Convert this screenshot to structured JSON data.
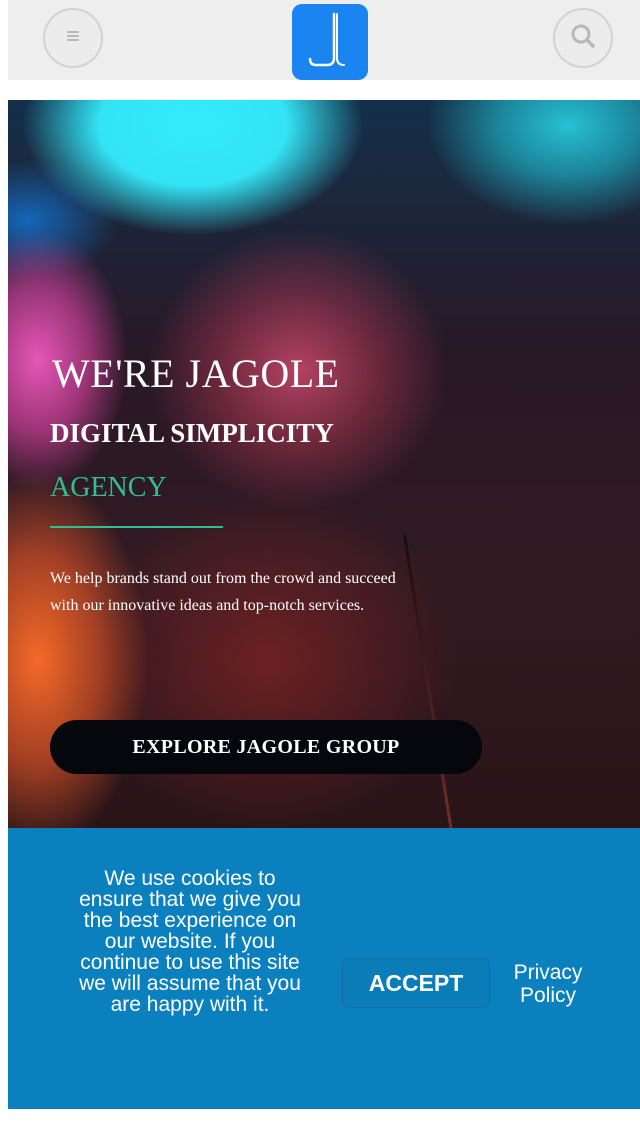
{
  "header": {
    "menu_icon": "hamburger-menu-icon",
    "search_icon": "search-icon",
    "logo_icon": "jagole-logo-icon",
    "logo_color": "#1a84f0"
  },
  "hero": {
    "title": "WE'RE JAGOLE",
    "subtitle": "DIGITAL SIMPLICITY",
    "agency": "AGENCY",
    "description": "We help brands stand out from the crowd and succeed with our innovative ideas and top-notch services.",
    "cta_label": "EXPLORE JAGOLE GROUP",
    "accent_color": "#2fbf91"
  },
  "cookie": {
    "message": "We use cookies to ensure that we give you the best experience on our website. If you continue to use this site we will assume that you are happy with it.",
    "accept_label": "ACCEPT",
    "privacy_label": "Privacy Policy",
    "background_color": "#0a80bf"
  }
}
